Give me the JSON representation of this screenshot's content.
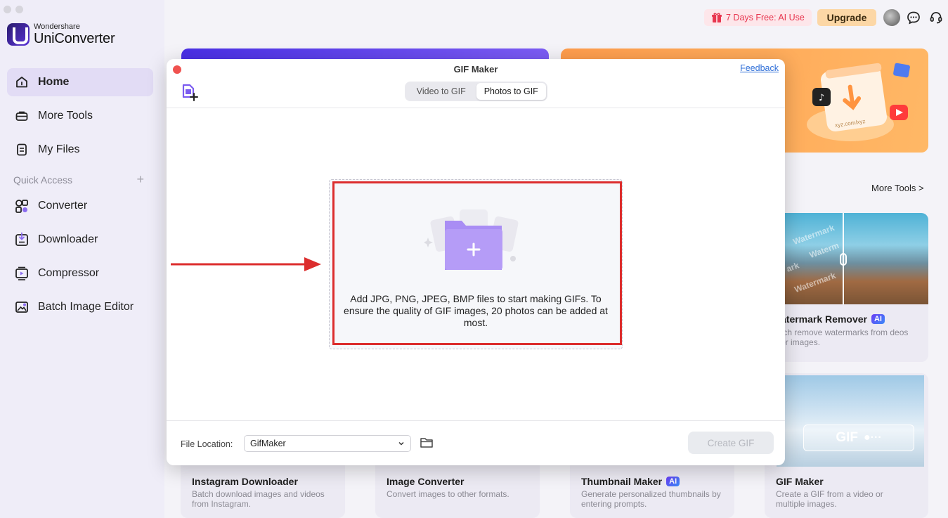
{
  "app": {
    "brand_small": "Wondershare",
    "brand_name": "UniConverter"
  },
  "sidebar": {
    "items": [
      {
        "label": "Home",
        "icon": "home-icon",
        "active": true
      },
      {
        "label": "More Tools",
        "icon": "toolbox-icon"
      },
      {
        "label": "My Files",
        "icon": "files-icon"
      }
    ],
    "quick_access_label": "Quick Access",
    "quick_items": [
      {
        "label": "Converter",
        "icon": "converter-icon"
      },
      {
        "label": "Downloader",
        "icon": "downloader-icon"
      },
      {
        "label": "Compressor",
        "icon": "compressor-icon"
      },
      {
        "label": "Batch Image Editor",
        "icon": "image-editor-icon"
      }
    ]
  },
  "header": {
    "promo": "7 Days Free: AI Use",
    "upgrade": "Upgrade"
  },
  "main": {
    "more_tools_link": "More Tools >",
    "cards": [
      {
        "title": "atermark Remover",
        "ai": "AI",
        "desc": "tch remove watermarks from deos or images."
      },
      {
        "title": "Instagram Downloader",
        "desc": "Batch download images and videos from Instagram."
      },
      {
        "title": "Image Converter",
        "desc": "Convert images to other formats."
      },
      {
        "title": "Thumbnail Maker",
        "ai": "AI",
        "desc": "Generate personalized thumbnails by entering prompts."
      },
      {
        "title": "GIF Maker",
        "desc": "Create a GIF from a video or multiple images."
      }
    ],
    "banner_url_text": "xyz.com/xyz",
    "wm_overlay": [
      "Watermark",
      "Waterm",
      "ark",
      "Watermark"
    ],
    "gif_pill": "GIF"
  },
  "modal": {
    "title": "GIF Maker",
    "feedback": "Feedback",
    "tabs": [
      {
        "label": "Video to GIF",
        "active": false
      },
      {
        "label": "Photos to GIF",
        "active": true
      }
    ],
    "drop_text": "Add JPG, PNG, JPEG, BMP files to start making GIFs. To ensure the quality of GIF images, 20 photos can be added at most.",
    "file_location_label": "File Location:",
    "file_location_value": "GifMaker",
    "create_button": "Create GIF"
  },
  "colors": {
    "accent": "#8b6cf0",
    "highlight": "#dc2d2d",
    "promo_text": "#e8364f",
    "upgrade_bg": "#fcd7a6"
  }
}
